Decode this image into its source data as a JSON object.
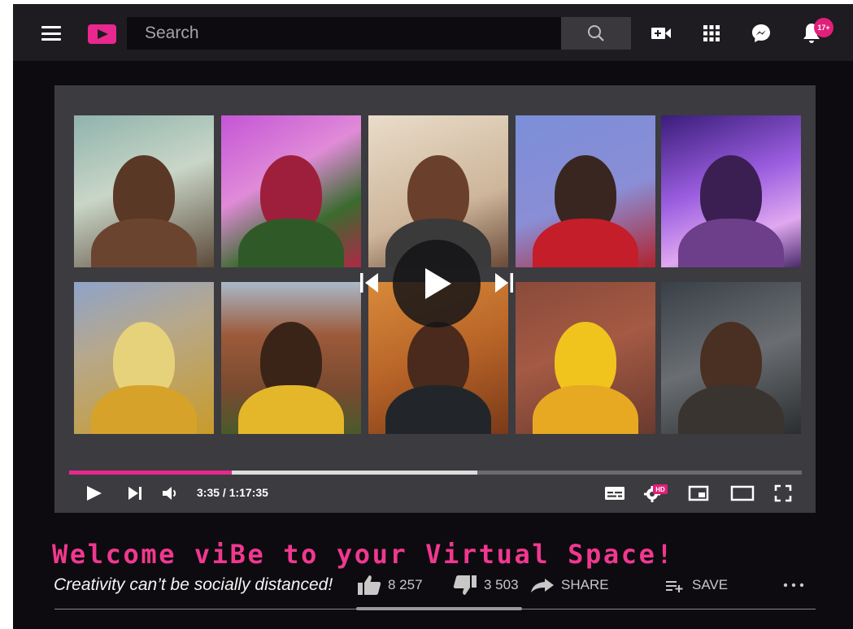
{
  "colors": {
    "accent": "#e8288f",
    "badge": "#e11f7b",
    "title": "#f0388f"
  },
  "header": {
    "menu_icon": "hamburger-menu-icon",
    "logo_icon": "play-logo-icon",
    "search": {
      "placeholder": "Search",
      "value": ""
    },
    "icons": [
      "create-video-icon",
      "apps-grid-icon",
      "messenger-icon",
      "notifications-bell-icon"
    ],
    "notification_count": "17+"
  },
  "player": {
    "grid_rows": 2,
    "grid_cols": 5,
    "photo_count": 10,
    "current_time": "3:35",
    "duration": "1:17:35",
    "time_label": "3:35 / 1:17:35",
    "played_fraction": 0.222,
    "buffered_fraction": 0.557,
    "hd_label": "HD",
    "controls_left": [
      "play-icon",
      "next-icon",
      "volume-icon"
    ],
    "controls_right": [
      "subtitles-icon",
      "settings-hd-icon",
      "miniplayer-icon",
      "theater-mode-icon",
      "fullscreen-icon"
    ]
  },
  "video": {
    "title": "Welcome viBe to your Virtual Space!",
    "subtitle": "Creativity can’t be socially distanced!",
    "likes": "8 257",
    "dislikes": "3 503",
    "share_label": "SHARE",
    "save_label": "SAVE",
    "more_icon": "more-options-icon"
  }
}
